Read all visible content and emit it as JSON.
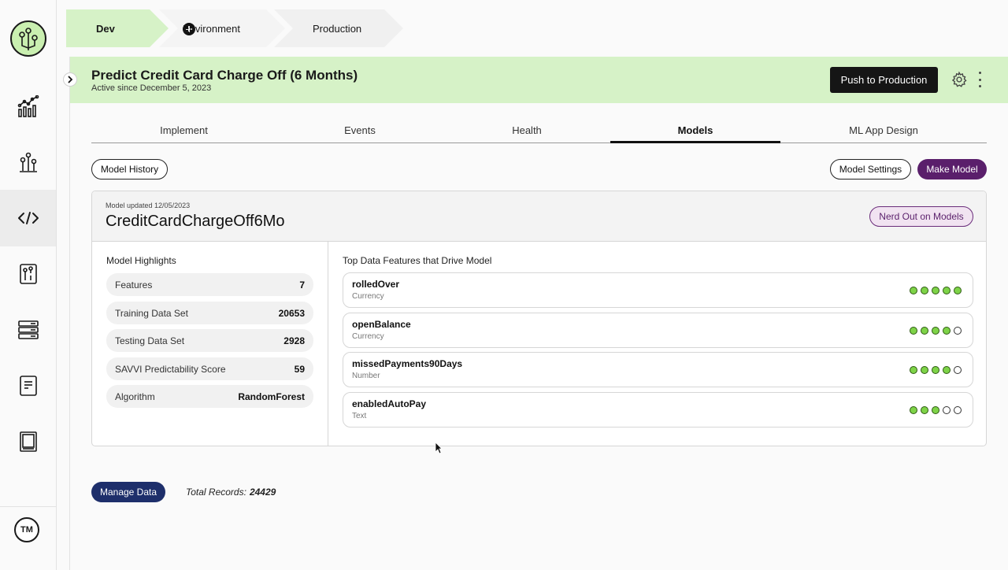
{
  "stages": {
    "dev": "Dev",
    "environment": "Environment",
    "production": "Production"
  },
  "header": {
    "title": "Predict Credit Card Charge Off (6 Months)",
    "subtitle": "Active since December 5, 2023",
    "push_label": "Push to Production"
  },
  "tabs": [
    "Implement",
    "Events",
    "Health",
    "Models",
    "ML App Design"
  ],
  "buttons": {
    "model_history": "Model History",
    "model_settings": "Model Settings",
    "make_model": "Make Model",
    "nerd_out": "Nerd Out on Models",
    "manage_data": "Manage Data"
  },
  "model": {
    "updated": "Model updated 12/05/2023",
    "name": "CreditCardChargeOff6Mo"
  },
  "highlights": {
    "title": "Model Highlights",
    "rows": [
      {
        "label": "Features",
        "value": "7"
      },
      {
        "label": "Training Data Set",
        "value": "20653"
      },
      {
        "label": "Testing Data Set",
        "value": "2928"
      },
      {
        "label": "SAVVI Predictability Score",
        "value": "59"
      },
      {
        "label": "Algorithm",
        "value": "RandomForest"
      }
    ]
  },
  "features": {
    "title": "Top Data Features that Drive Model",
    "items": [
      {
        "name": "rolledOver",
        "type": "Currency",
        "score": 5
      },
      {
        "name": "openBalance",
        "type": "Currency",
        "score": 4
      },
      {
        "name": "missedPayments90Days",
        "type": "Number",
        "score": 4
      },
      {
        "name": "enabledAutoPay",
        "type": "Text",
        "score": 3
      }
    ],
    "max_score": 5
  },
  "footer": {
    "total_label": "Total Records:",
    "total_value": "24429"
  },
  "user": {
    "initials": "TM"
  },
  "colors": {
    "accent_green": "#d6f2c7",
    "purple": "#5a1f6b",
    "navy": "#1e2f6b",
    "dot_on": "#7ed348"
  }
}
